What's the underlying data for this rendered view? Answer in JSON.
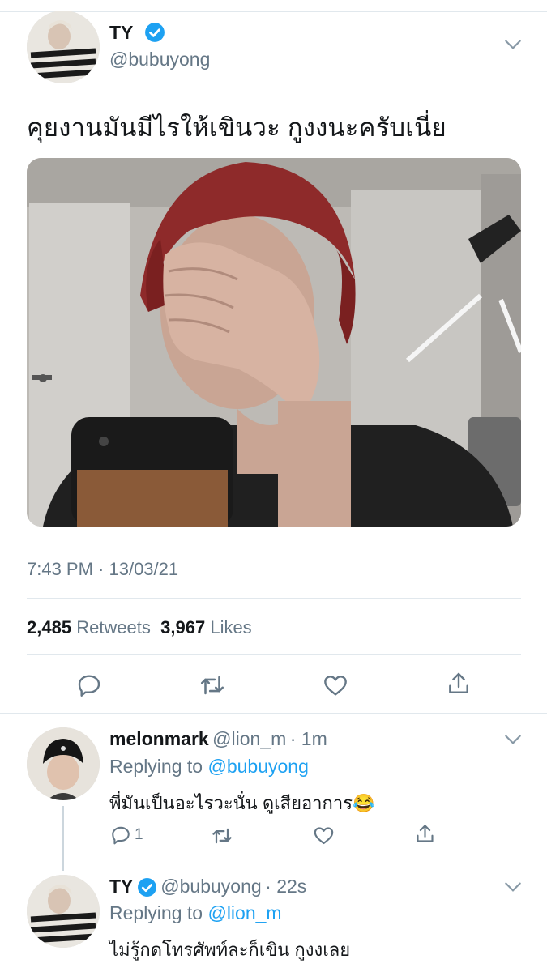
{
  "main_tweet": {
    "display_name": "TY",
    "handle": "@bubuyong",
    "text": "คุยงานมันมีไรให้เขินวะ กูงงนะครับเนี่ย",
    "timestamp": "7:43 PM · 13/03/21",
    "retweets_count": "2,485",
    "retweets_label": "Retweets",
    "likes_count": "3,967",
    "likes_label": "Likes",
    "photo_icon": "photo-person-covering-face"
  },
  "replies": [
    {
      "display_name": "melonmark",
      "handle": "@lion_m",
      "time": "· 1m",
      "replying_label": "Replying to",
      "replying_to": "@bubuyong",
      "text": "พี่มันเป็นอะไรวะนั่น ดูเสียอาการ",
      "emoji": "😂",
      "reply_count": "1"
    },
    {
      "display_name": "TY",
      "handle": "@bubuyong",
      "time": "· 22s",
      "replying_label": "Replying to",
      "replying_to": "@lion_m",
      "text": "ไม่รู้กดโทรศัพท์ละก็เขิน กูงงเลย"
    }
  ],
  "colors": {
    "accent": "#1da1f2",
    "muted": "#657786",
    "divider": "#e1e8ed",
    "text": "#14171a"
  }
}
